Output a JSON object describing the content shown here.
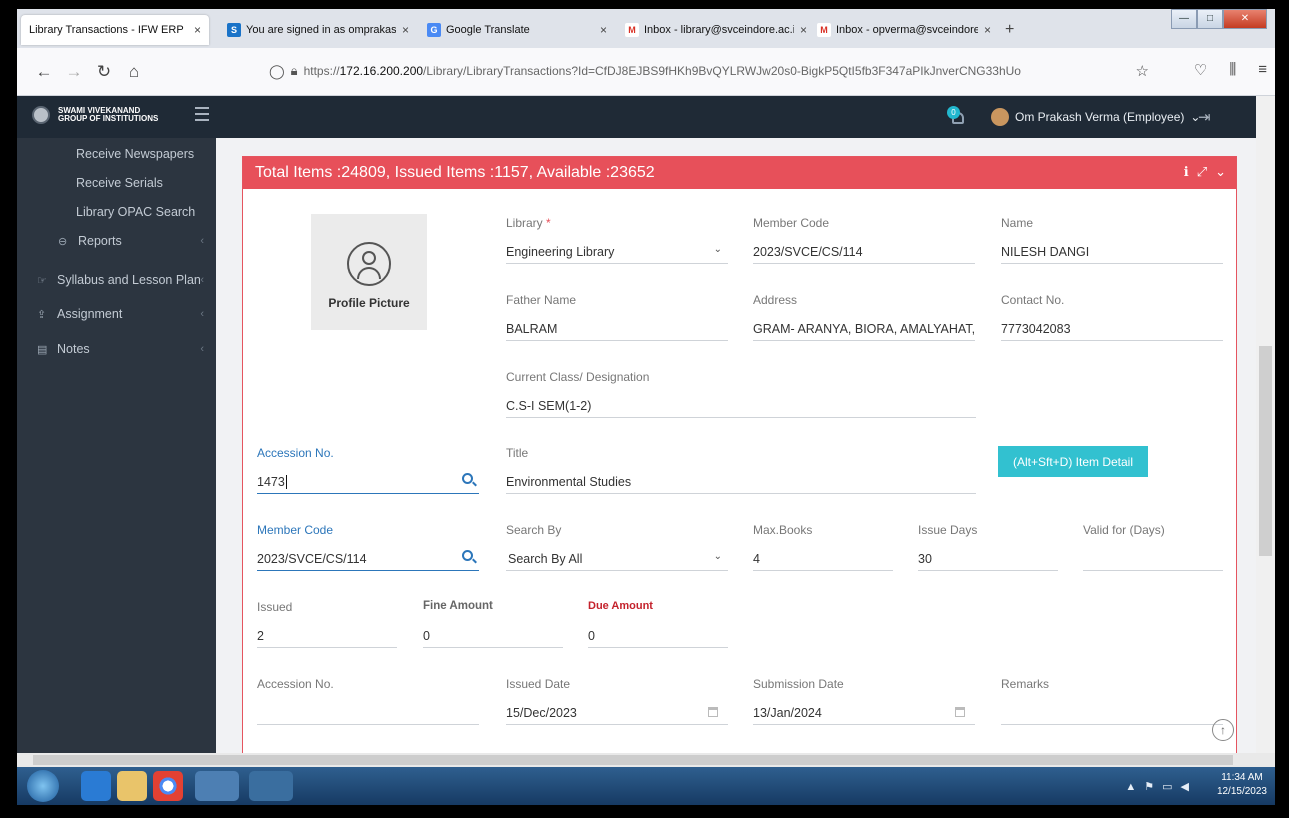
{
  "browser": {
    "tabs": [
      {
        "label": "Library Transactions - IFW ERP",
        "fav": "",
        "favcolor": "#ffffff",
        "active": true
      },
      {
        "label": "You are signed in as omprakash",
        "fav": "S",
        "favcolor": "#1a73c8",
        "active": false
      },
      {
        "label": "Google Translate",
        "fav": "G",
        "favcolor": "#4a8af4",
        "active": false
      },
      {
        "label": "Inbox - library@svceindore.ac.in",
        "fav": "M",
        "favcolor": "#d93025",
        "active": false
      },
      {
        "label": "Inbox - opverma@svceindore.ac",
        "fav": "M",
        "favcolor": "#d93025",
        "active": false
      }
    ],
    "close_glyph": "×",
    "new_tab_glyph": "+",
    "url_prefix": "https://",
    "url_host": "172.16.200.200",
    "url_path": "/Library/LibraryTransactions?Id=CfDJ8EJBS9fHKh9BvQYLRWJw20s0-BigkP5QtI5fb3F347aPIkJnverCNG33hUo",
    "window_controls": [
      "—",
      "□",
      "✕"
    ]
  },
  "header": {
    "logo_line1": "SWAMI VIVEKANAND",
    "logo_line2": "GROUP OF INSTITUTIONS",
    "notification_count": "0",
    "user_name": "Om Prakash Verma (Employee)",
    "user_chevron": "⌄",
    "logout_glyph": "⇥"
  },
  "sidebar": {
    "items": [
      {
        "label": "Receive Newspapers"
      },
      {
        "label": "Receive Serials"
      },
      {
        "label": "Library OPAC Search"
      },
      {
        "label": "Reports"
      },
      {
        "label": "Syllabus and Lesson Plan"
      },
      {
        "label": "Assignment"
      },
      {
        "label": "Notes"
      }
    ],
    "chevron": "‹"
  },
  "panel": {
    "title": "Total Items :24809, Issued Items :1157, Available :23652",
    "tools": [
      "ℹ",
      "⤢",
      "⌄"
    ],
    "profile_label": "Profile Picture"
  },
  "fields": {
    "library_label": "Library",
    "library_required": "*",
    "library_value": "Engineering Library",
    "member_code_label": "Member Code",
    "member_code_value": "2023/SVCE/CS/114",
    "name_label": "Name",
    "name_value": "NILESH DANGI",
    "father_label": "Father Name",
    "father_value": "BALRAM",
    "address_label": "Address",
    "address_value": "GRAM- ARANYA, BIORA, AMALYAHAT, ...",
    "contact_label": "Contact No.",
    "contact_value": "7773042083",
    "class_label": "Current Class/ Designation",
    "class_value": "C.S-I SEM(1-2)",
    "accession_label": "Accession No.",
    "accession_value": "1473",
    "title_label": "Title",
    "title_value": "Environmental Studies",
    "item_detail_button": "(Alt+Sft+D) Item Detail",
    "member_code2_label": "Member Code",
    "member_code2_value": "2023/SVCE/CS/114",
    "search_by_label": "Search By",
    "search_by_value": "Search By All",
    "max_books_label": "Max.Books",
    "max_books_value": "4",
    "issue_days_label": "Issue Days",
    "issue_days_value": "30",
    "valid_for_label": "Valid for (Days)",
    "valid_for_value": "",
    "issued_label": "Issued",
    "issued_value": "2",
    "fine_label": "Fine Amount",
    "fine_value": "0",
    "due_label": "Due Amount",
    "due_value": "0",
    "accession2_label": "Accession No.",
    "accession2_value": "",
    "issued_date_label": "Issued Date",
    "issued_date_value": "15/Dec/2023",
    "submission_date_label": "Submission Date",
    "submission_date_value": "13/Jan/2024",
    "remarks_label": "Remarks",
    "remarks_value": ""
  },
  "taskbar": {
    "time": "11:34 AM",
    "date": "12/15/2023"
  },
  "colors": {
    "panel_header": "#e7505a",
    "accent_blue": "#2c76ba",
    "button_cyan": "#32c1d0",
    "sidebar_bg": "#2c3540",
    "appbar_bg": "#1f2a36"
  }
}
